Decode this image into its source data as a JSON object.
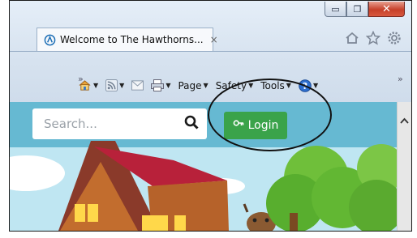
{
  "window": {
    "minimize_glyph": "▭",
    "restore_glyph": "❐",
    "close_glyph": "✕"
  },
  "tab": {
    "title": "Welcome to The Hawthorns...",
    "close_glyph": "×"
  },
  "toolbar_icons": [
    "home-icon",
    "favorites-star-icon",
    "settings-gear-icon"
  ],
  "command_bar": {
    "chevron": "»",
    "chevron_right": "»",
    "page_label": "Page",
    "safety_label": "Safety",
    "tools_label": "Tools"
  },
  "site": {
    "search_placeholder": "Search...",
    "login_label": "Login"
  },
  "colors": {
    "site_header": "#66b9d2",
    "login_button": "#3aa34a",
    "close_button": "#c6402a"
  }
}
